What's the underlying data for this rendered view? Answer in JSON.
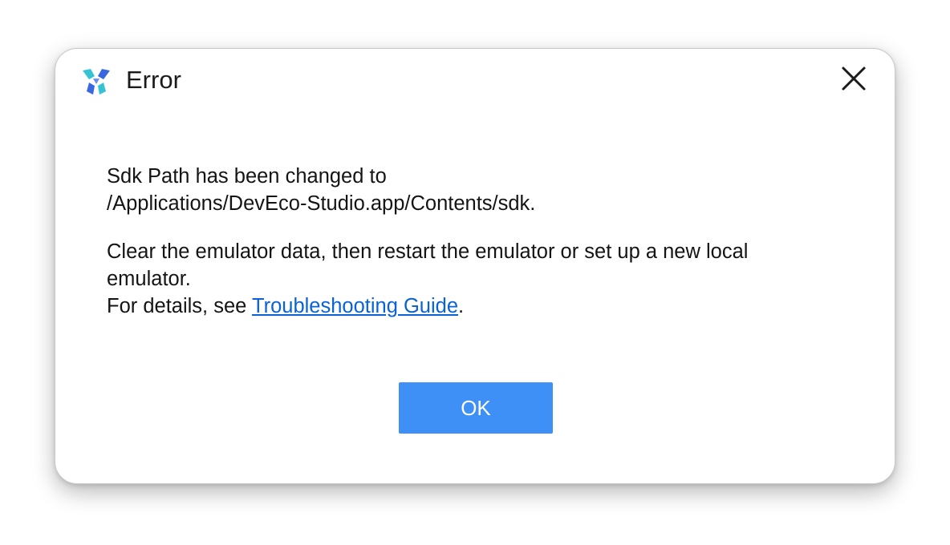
{
  "dialog": {
    "title": "Error",
    "app_icon": "deveco-studio-logo-icon",
    "close_icon": "close-icon",
    "message": {
      "line1": "Sdk Path has been changed to",
      "line2": "/Applications/DevEco-Studio.app/Contents/sdk.",
      "line3": "Clear the emulator data, then restart the emulator or set up a new local",
      "line4": "emulator.",
      "details_prefix": "For details, see ",
      "details_link": "Troubleshooting Guide",
      "details_suffix": "."
    },
    "ok_label": "OK"
  },
  "colors": {
    "link": "#0a63d6",
    "primary_button": "#3e8ff6",
    "logo_teal": "#35c3d3",
    "logo_blue": "#3a66e0"
  }
}
